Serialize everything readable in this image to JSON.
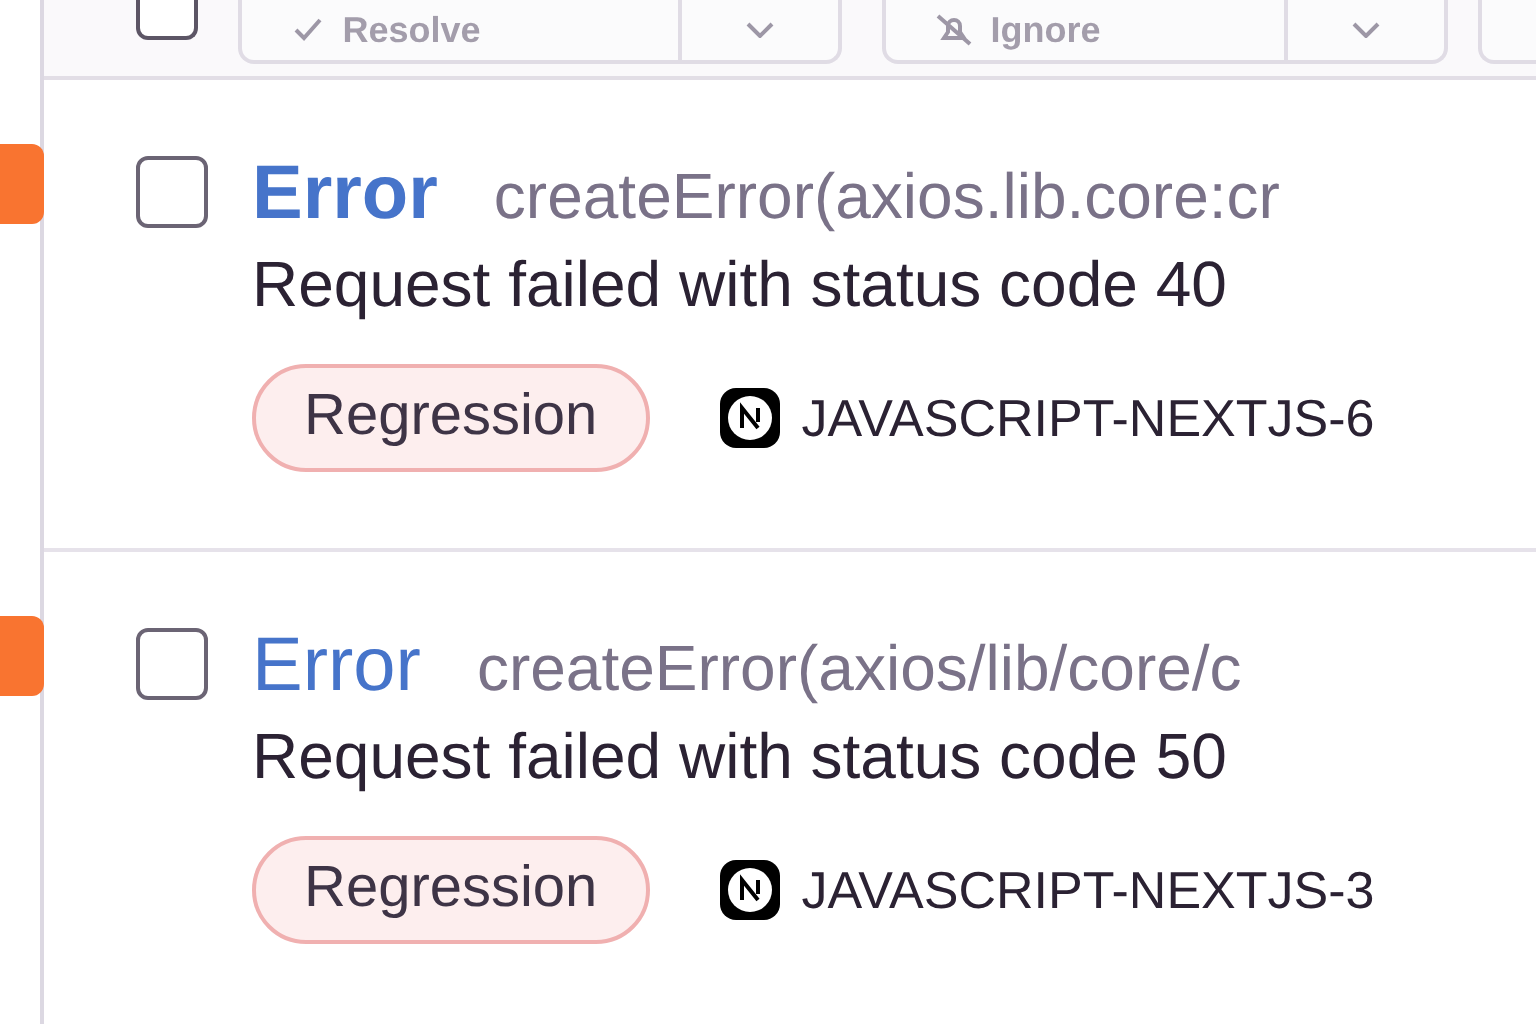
{
  "toolbar": {
    "select_all": {
      "checked": false
    },
    "buttons": [
      {
        "kind": "resolve",
        "label": "Resolve"
      },
      {
        "kind": "ignore",
        "label": "Ignore"
      }
    ]
  },
  "issues": [
    {
      "color": "#f97430",
      "checked": false,
      "unread": true,
      "type": "Error",
      "culprit": "createError(axios.lib.core:cr",
      "message": "Request failed with status code 40",
      "badge": "Regression",
      "project": "JAVASCRIPT-NEXTJS-6"
    },
    {
      "color": "#f97430",
      "checked": false,
      "unread": false,
      "type": "Error",
      "culprit": "createError(axios/lib/core/c",
      "message": "Request failed with status code 50",
      "badge": "Regression",
      "project": "JAVASCRIPT-NEXTJS-3"
    }
  ]
}
